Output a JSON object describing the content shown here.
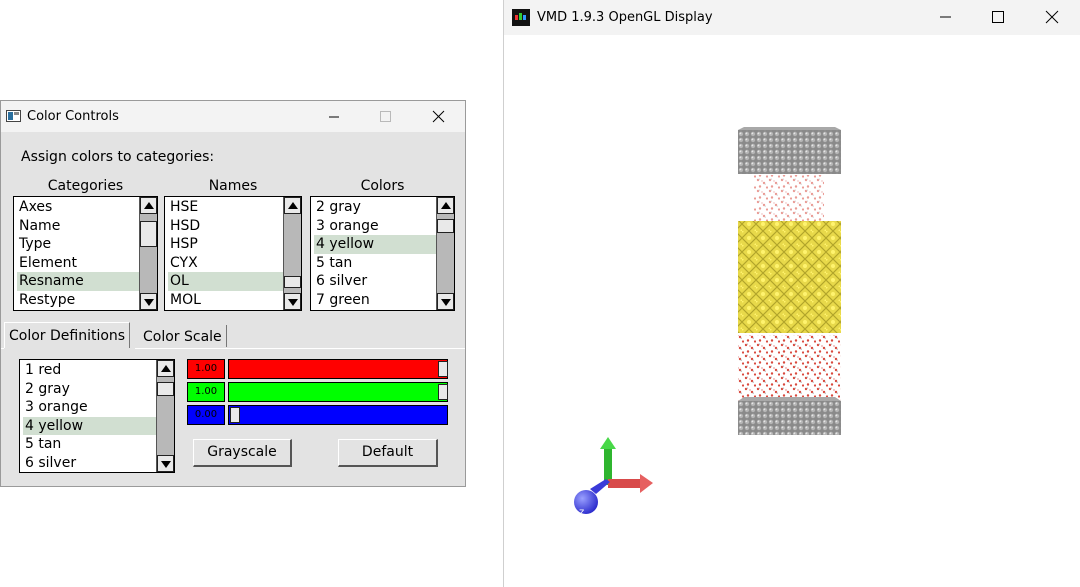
{
  "color_controls": {
    "title": "Color Controls",
    "assign_label": "Assign colors to categories:",
    "categories_header": "Categories",
    "names_header": "Names",
    "colors_header": "Colors",
    "categories": [
      "Axes",
      "Name",
      "Type",
      "Element",
      "Resname",
      "Restype"
    ],
    "categories_selected": "Resname",
    "names": [
      "HSE",
      "HSD",
      "HSP",
      "CYX",
      "OL",
      "MOL"
    ],
    "names_selected": "OL",
    "colors": [
      "2 gray",
      "3 orange",
      "4 yellow",
      "5 tan",
      "6 silver",
      "7 green"
    ],
    "colors_selected": "4 yellow",
    "tabs": [
      "Color Definitions",
      "Color Scale"
    ],
    "active_tab": "Color Definitions",
    "definitions": [
      "1 red",
      "2 gray",
      "3 orange",
      "4 yellow",
      "5 tan",
      "6 silver"
    ],
    "definitions_selected": "4 yellow",
    "sliders": [
      {
        "channel": "red",
        "value": "1.00",
        "fraction": 1.0,
        "color": "#ff0000"
      },
      {
        "channel": "green",
        "value": "1.00",
        "fraction": 1.0,
        "color": "#00ff00"
      },
      {
        "channel": "blue",
        "value": "0.00",
        "fraction": 0.0,
        "color": "#0000ff"
      }
    ],
    "grayscale_label": "Grayscale",
    "default_label": "Default"
  },
  "vmd_display": {
    "title": "VMD 1.9.3 OpenGL Display",
    "axis_label": "z",
    "molecule_colors": {
      "slab": "#8a8a8a",
      "membrane": "#e8d94a",
      "water_o": "#d9493e",
      "water_h": "#ffffff"
    }
  },
  "icons": {
    "minimize": "minimize-icon",
    "maximize": "maximize-icon",
    "close": "close-icon"
  }
}
